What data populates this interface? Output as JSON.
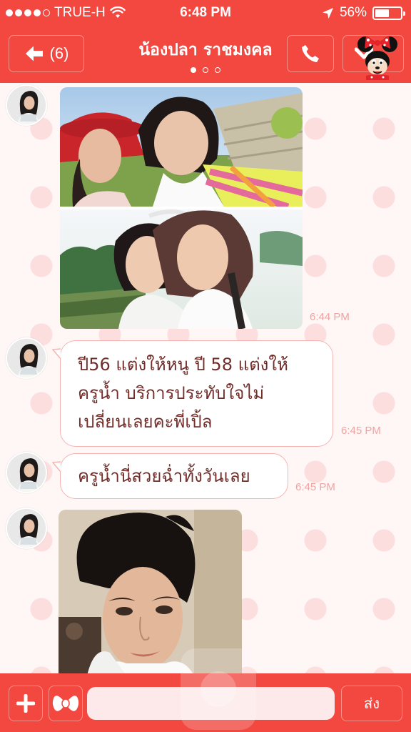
{
  "status_bar": {
    "carrier": "TRUE-H",
    "time": "6:48 PM",
    "battery": "56%",
    "battery_level": 0.56,
    "icons": [
      "signal-dots",
      "wifi-icon",
      "location-arrow-icon",
      "battery-icon"
    ]
  },
  "header": {
    "back_label": "(6)",
    "title": "น้องปลา ราชมงคล",
    "page_count": 3,
    "active_page": 1,
    "icons": [
      "back-arrow-icon",
      "phone-icon",
      "chevron-down-icon",
      "minnie-mouse-icon"
    ]
  },
  "messages": [
    {
      "type": "image",
      "description": "photo-collage",
      "time": "6:44 PM"
    },
    {
      "type": "text",
      "lines": [
        "ปี56 แต่งให้หนู ปี 58 แต่งให้",
        "ครูน้ำ บริการประทับใจไม่",
        "เปลี่ยนเลยคะพี่เปิ้ล"
      ],
      "time": "6:45 PM"
    },
    {
      "type": "text",
      "lines": [
        "ครูน้ำนี่สวยฉ่ำทั้งวันเลย"
      ],
      "time": "6:45 PM"
    },
    {
      "type": "image",
      "description": "portrait-photo",
      "time": ""
    }
  ],
  "footer": {
    "send_label": "ส่ง",
    "input_placeholder": "",
    "icons": [
      "plus-icon",
      "bow-sticker-icon"
    ]
  },
  "colors": {
    "bar": "#f24840",
    "bubble_text": "#722d2a",
    "timestamp": "#f2a3a0",
    "bubble_border": "#f6b4b1",
    "background": "#fff6f6",
    "polka_dot": "#fcdede"
  }
}
